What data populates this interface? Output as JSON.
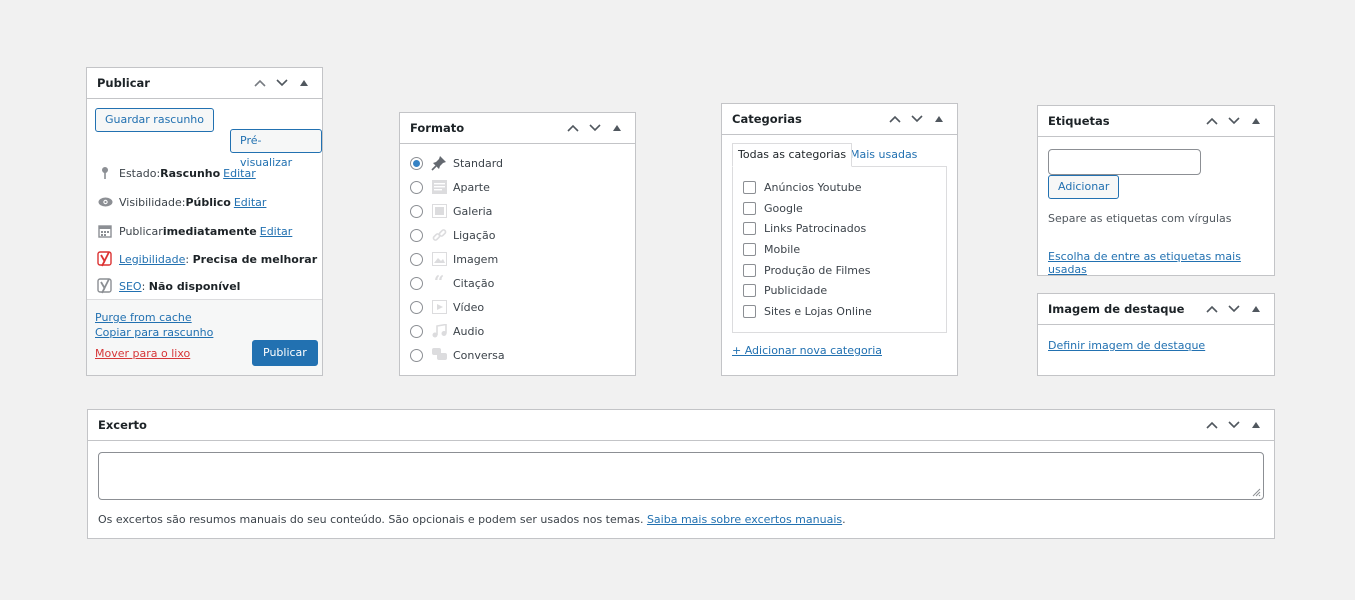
{
  "publish": {
    "title": "Publicar",
    "save_draft": "Guardar rascunho",
    "preview": "Pré-visualizar",
    "status_label": "Estado: ",
    "status_value": "Rascunho",
    "status_edit": "Editar",
    "visibility_label": "Visibilidade: ",
    "visibility_value": "Público",
    "visibility_edit": "Editar",
    "publish_label": "Publicar ",
    "publish_value": "imediatamente",
    "publish_edit": "Editar",
    "readability_link": "Legibilidade",
    "readability_sep": ": ",
    "readability_value": "Precisa de melhorar",
    "seo_link": "SEO",
    "seo_sep": ": ",
    "seo_value": "Não disponível",
    "purge_cache": "Purge from cache",
    "copy_draft": "Copiar para rascunho",
    "trash": "Mover para o lixo",
    "publish_button": "Publicar"
  },
  "format": {
    "title": "Formato",
    "options": [
      {
        "label": "Standard",
        "icon": "pin-icon",
        "selected": true
      },
      {
        "label": "Aparte",
        "icon": "aside-icon",
        "selected": false
      },
      {
        "label": "Galeria",
        "icon": "gallery-icon",
        "selected": false
      },
      {
        "label": "Ligação",
        "icon": "link-icon",
        "selected": false
      },
      {
        "label": "Imagem",
        "icon": "image-icon",
        "selected": false
      },
      {
        "label": "Citação",
        "icon": "quote-icon",
        "selected": false
      },
      {
        "label": "Vídeo",
        "icon": "video-icon",
        "selected": false
      },
      {
        "label": "Audio",
        "icon": "audio-icon",
        "selected": false
      },
      {
        "label": "Conversa",
        "icon": "chat-icon",
        "selected": false
      }
    ]
  },
  "categories": {
    "title": "Categorias",
    "tab_all": "Todas as categorias",
    "tab_used": "Mais usadas",
    "items": [
      "Anúncios Youtube",
      "Google",
      "Links Patrocinados",
      "Mobile",
      "Produção de Filmes",
      "Publicidade",
      "Sites e Lojas Online"
    ],
    "add_new": "+ Adicionar nova categoria"
  },
  "tags": {
    "title": "Etiquetas",
    "input_value": "",
    "add_button": "Adicionar",
    "hint": "Separe as etiquetas com vírgulas",
    "choose_link": "Escolha de entre as etiquetas mais usadas"
  },
  "featured": {
    "title": "Imagem de destaque",
    "set_link": "Definir imagem de destaque"
  },
  "excerpt": {
    "title": "Excerto",
    "value": "",
    "help": "Os excertos são resumos manuais do seu conteúdo. São opcionais e podem ser usados nos temas. ",
    "help_link": "Saiba mais sobre excertos manuais",
    "help_end": "."
  },
  "colors": {
    "accent": "#2271b1",
    "danger": "#d63638",
    "yoast_red": "#dc3232"
  }
}
